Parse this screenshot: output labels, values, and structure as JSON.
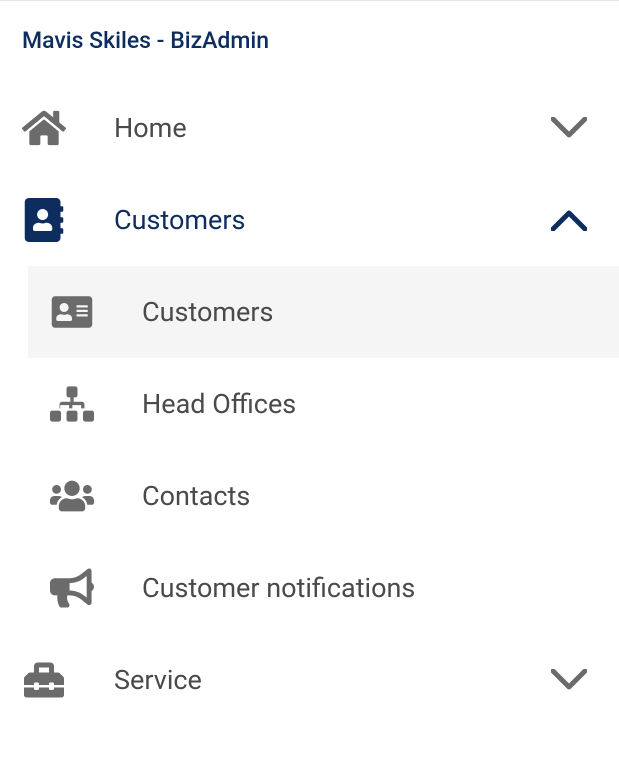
{
  "header": {
    "userRole": "Mavis Skiles - BizAdmin"
  },
  "nav": {
    "home": {
      "label": "Home",
      "expanded": false
    },
    "customers": {
      "label": "Customers",
      "expanded": true,
      "children": {
        "customers": {
          "label": "Customers",
          "selected": true
        },
        "headOffices": {
          "label": "Head Offices",
          "selected": false
        },
        "contacts": {
          "label": "Contacts",
          "selected": false
        },
        "notifications": {
          "label": "Customer notifications",
          "selected": false
        }
      }
    },
    "service": {
      "label": "Service",
      "expanded": false
    }
  },
  "colors": {
    "brand": "#0d2d5e",
    "iconGray": "#6b6b6b",
    "textGray": "#4a4a4a",
    "selectedBg": "#f5f5f5"
  }
}
